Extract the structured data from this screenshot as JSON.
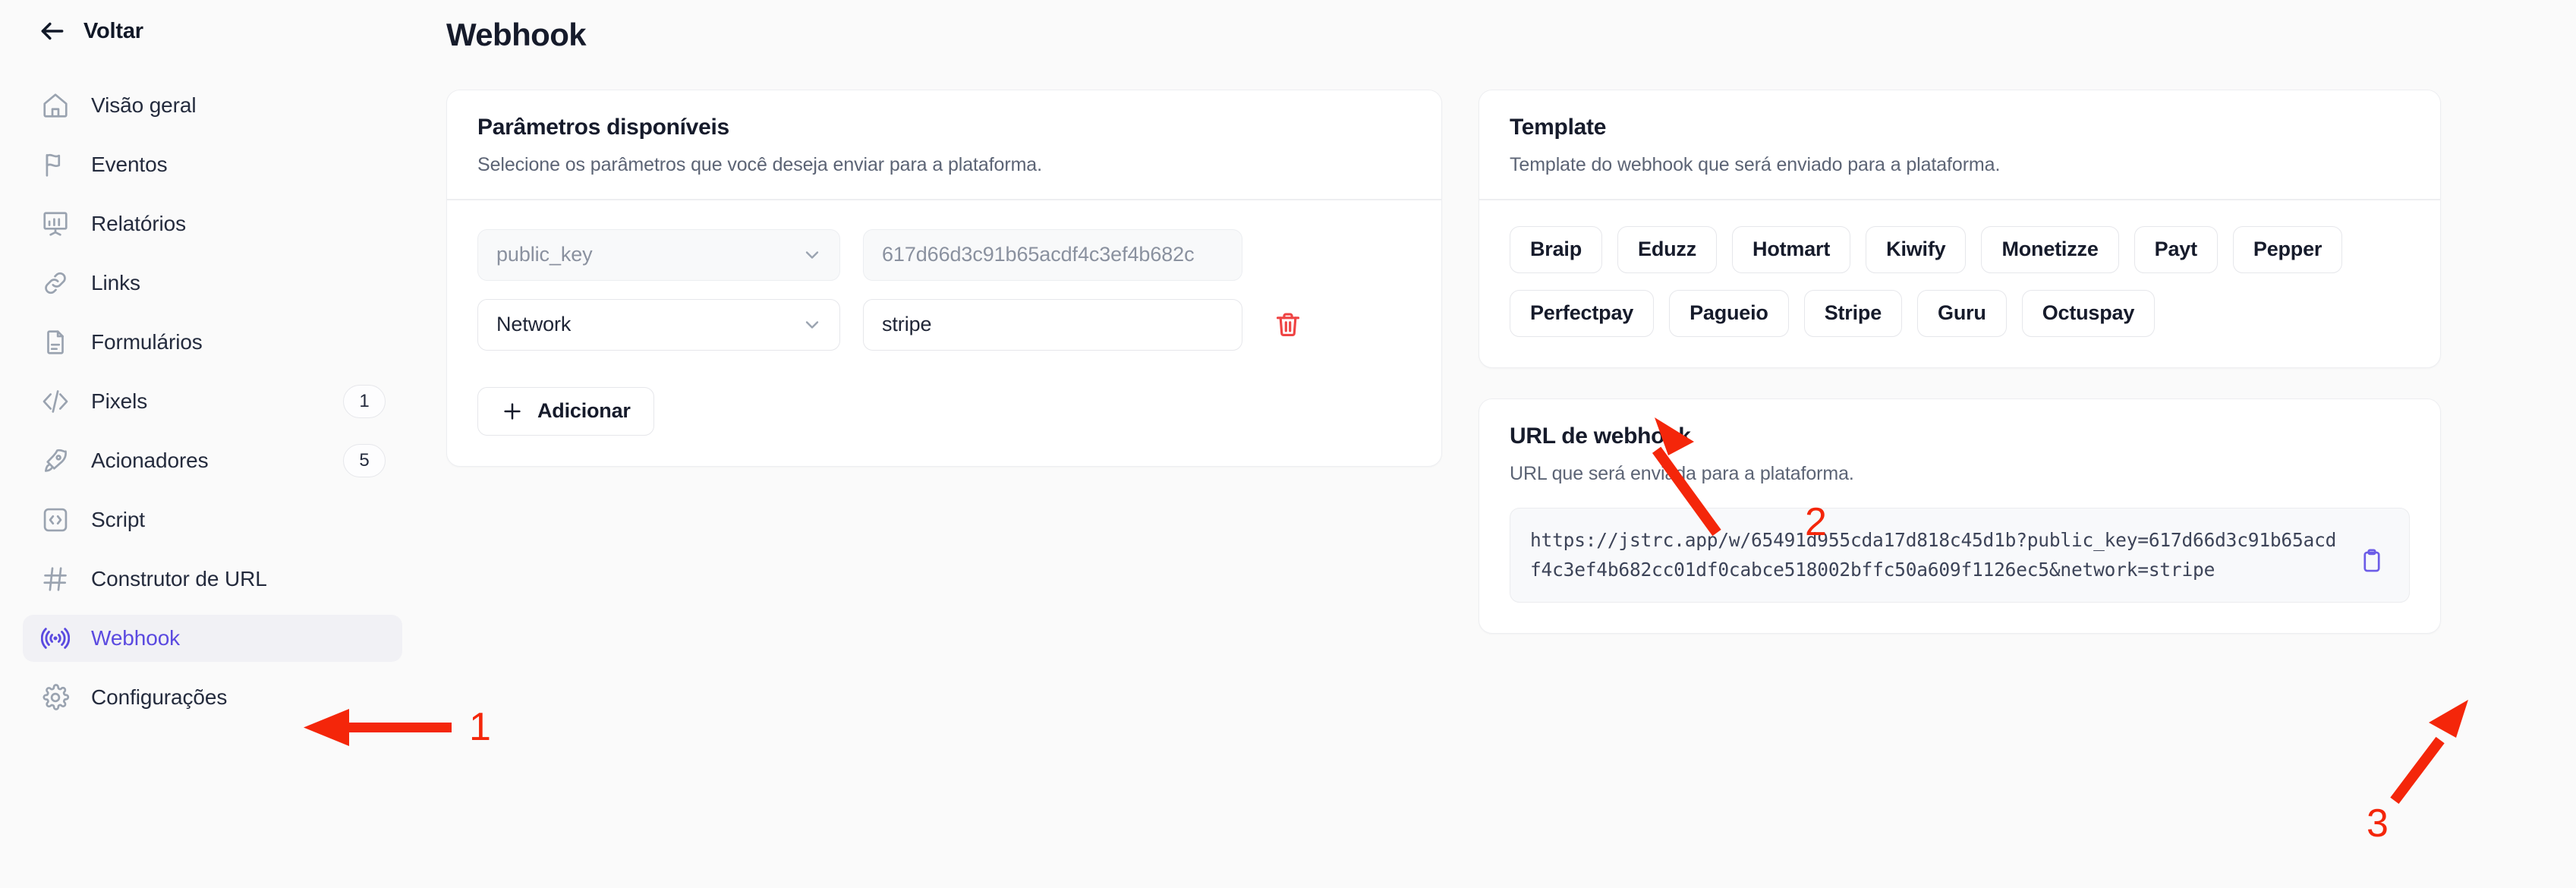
{
  "sidebar": {
    "back_label": "Voltar",
    "items": [
      {
        "label": "Visão geral",
        "icon": "home-icon",
        "badge": null,
        "active": false
      },
      {
        "label": "Eventos",
        "icon": "flag-icon",
        "badge": null,
        "active": false
      },
      {
        "label": "Relatórios",
        "icon": "chart-board-icon",
        "badge": null,
        "active": false
      },
      {
        "label": "Links",
        "icon": "link-icon",
        "badge": null,
        "active": false
      },
      {
        "label": "Formulários",
        "icon": "document-icon",
        "badge": null,
        "active": false
      },
      {
        "label": "Pixels",
        "icon": "code-slash-icon",
        "badge": "1",
        "active": false
      },
      {
        "label": "Acionadores",
        "icon": "rocket-icon",
        "badge": "5",
        "active": false
      },
      {
        "label": "Script",
        "icon": "code-box-icon",
        "badge": null,
        "active": false
      },
      {
        "label": "Construtor de URL",
        "icon": "hash-icon",
        "badge": null,
        "active": false
      },
      {
        "label": "Webhook",
        "icon": "broadcast-icon",
        "badge": null,
        "active": true
      },
      {
        "label": "Configurações",
        "icon": "gear-icon",
        "badge": null,
        "active": false
      }
    ]
  },
  "header": {
    "title": "Webhook"
  },
  "params_card": {
    "title": "Parâmetros disponíveis",
    "subtitle": "Selecione os parâmetros que você deseja enviar para a plataforma.",
    "rows": [
      {
        "key": "public_key",
        "value": "617d66d3c91b65acdf4c3ef4b682c",
        "disabled": true,
        "deletable": false
      },
      {
        "key": "Network",
        "value": "stripe",
        "disabled": false,
        "deletable": true
      }
    ],
    "add_label": "Adicionar"
  },
  "template_card": {
    "title": "Template",
    "subtitle": "Template do webhook que será enviado para a plataforma.",
    "chips": [
      "Braip",
      "Eduzz",
      "Hotmart",
      "Kiwify",
      "Monetizze",
      "Payt",
      "Pepper",
      "Perfectpay",
      "Pagueio",
      "Stripe",
      "Guru",
      "Octuspay"
    ]
  },
  "url_card": {
    "title": "URL de webhook",
    "subtitle": "URL que será enviada para a plataforma.",
    "url": "https://jstrc.app/w/65491d955cda17d818c45d1b?public_key=617d66d3c91b65acdf4c3ef4b682cc01df0cabce518002bffc50a609f1126ec5&network=stripe",
    "copy_icon": "clipboard-icon"
  },
  "annotations": [
    {
      "number": "1",
      "target": "sidebar-item-webhook"
    },
    {
      "number": "2",
      "target": "chip-stripe"
    },
    {
      "number": "3",
      "target": "copy-url-button"
    }
  ],
  "colors": {
    "accent": "#5b4ae0",
    "annotation": "#f4260a",
    "danger": "#ef4444",
    "copy": "#6c5ce7"
  }
}
